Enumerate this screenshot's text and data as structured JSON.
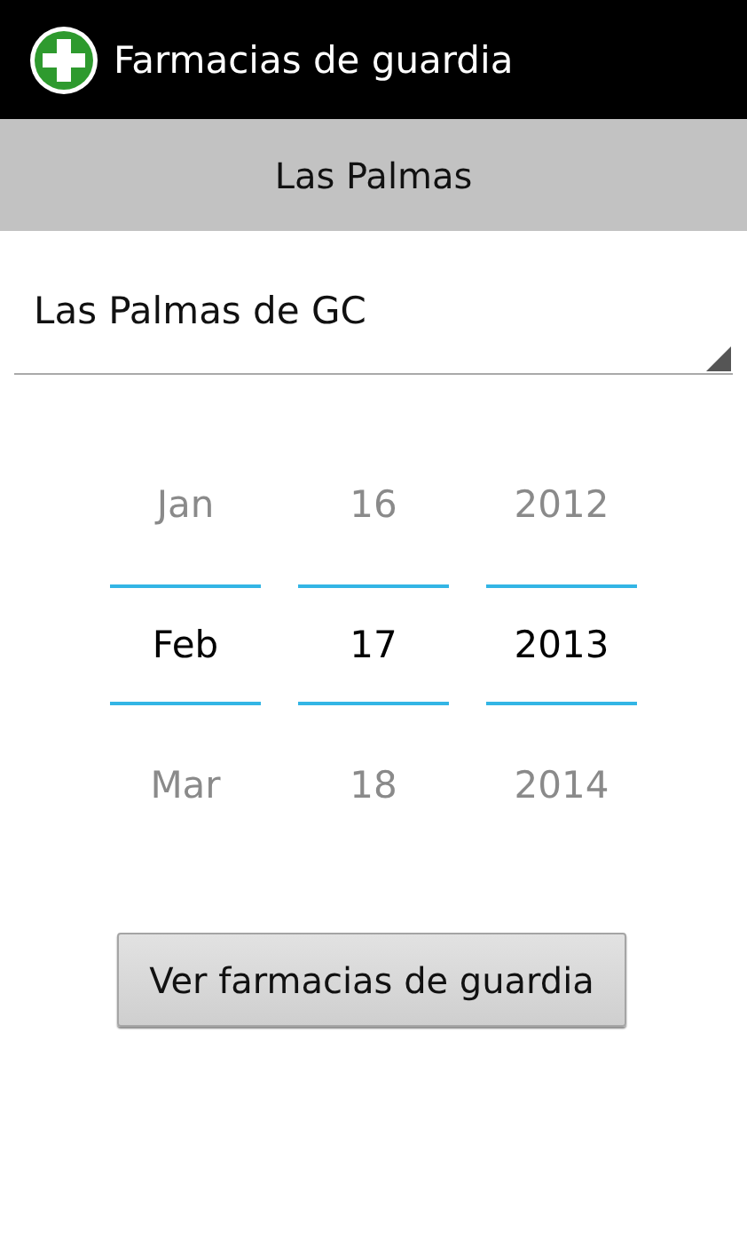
{
  "action_bar": {
    "title": "Farmacias de guardia"
  },
  "header": {
    "label": "Las Palmas"
  },
  "spinner": {
    "value": "Las Palmas de GC"
  },
  "date_picker": [
    {
      "values": [
        {
          "text": "Jan",
          "selected": false
        },
        {
          "text": "Feb",
          "selected": true
        },
        {
          "text": "Mar",
          "selected": false
        }
      ]
    },
    {
      "values": [
        {
          "text": "16",
          "selected": false
        },
        {
          "text": "17",
          "selected": true
        },
        {
          "text": "18",
          "selected": false
        }
      ]
    },
    {
      "values": [
        {
          "text": "2012",
          "selected": false
        },
        {
          "text": "2013",
          "selected": true
        },
        {
          "text": "2014",
          "selected": false
        }
      ]
    }
  ],
  "button": {
    "label": "Ver farmacias de guardia"
  }
}
